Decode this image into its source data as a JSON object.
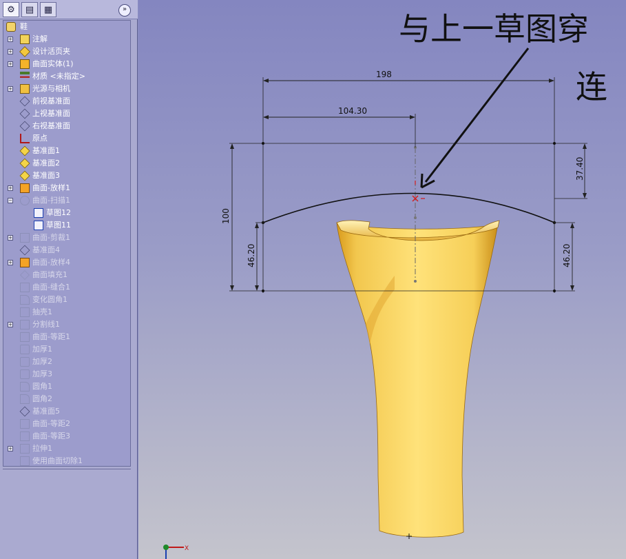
{
  "feature_tree": {
    "root": "鞋",
    "items": [
      {
        "label": "注解",
        "icon": "annotation-icon",
        "expander": "plus",
        "dim": false
      },
      {
        "label": "设计活页夹",
        "icon": "design-binder-icon",
        "expander": "plus",
        "dim": false
      },
      {
        "label": "曲面实体(1)",
        "icon": "surface-bodies-icon",
        "expander": "plus",
        "dim": false
      },
      {
        "label": "材质 <未指定>",
        "icon": "material-icon",
        "expander": "none",
        "dim": false
      },
      {
        "label": "光源与相机",
        "icon": "lights-icon",
        "expander": "plus",
        "dim": false
      },
      {
        "label": "前视基准面",
        "icon": "plane-icon",
        "expander": "none",
        "dim": false
      },
      {
        "label": "上视基准面",
        "icon": "plane-icon",
        "expander": "none",
        "dim": false
      },
      {
        "label": "右视基准面",
        "icon": "plane-icon",
        "expander": "none",
        "dim": false
      },
      {
        "label": "原点",
        "icon": "origin-icon",
        "expander": "none",
        "dim": false
      },
      {
        "label": "基准面1",
        "icon": "ref-plane-icon",
        "expander": "none",
        "dim": false
      },
      {
        "label": "基准面2",
        "icon": "ref-plane-icon",
        "expander": "none",
        "dim": false
      },
      {
        "label": "基准面3",
        "icon": "ref-plane-icon",
        "expander": "none",
        "dim": false
      },
      {
        "label": "曲面-放样1",
        "icon": "loft-icon",
        "expander": "plus",
        "dim": false
      },
      {
        "label": "曲面-扫描1",
        "icon": "sweep-icon",
        "expander": "minus",
        "dim": true
      },
      {
        "label": "草图12",
        "icon": "sketch-icon",
        "expander": "none",
        "dim": false,
        "sub": true
      },
      {
        "label": "草图11",
        "icon": "sketch-icon",
        "expander": "none",
        "dim": false,
        "sub": true
      },
      {
        "label": "曲面-剪裁1",
        "icon": "trim-icon",
        "expander": "plus",
        "dim": true
      },
      {
        "label": "基准面4",
        "icon": "plane-icon",
        "expander": "none",
        "dim": true
      },
      {
        "label": "曲面-放样4",
        "icon": "loft-icon",
        "expander": "plus",
        "dim": true
      },
      {
        "label": "曲面填充1",
        "icon": "fill-icon",
        "expander": "none",
        "dim": true
      },
      {
        "label": "曲面-缝合1",
        "icon": "knit-icon",
        "expander": "none",
        "dim": true
      },
      {
        "label": "变化圆角1",
        "icon": "fillet-icon",
        "expander": "none",
        "dim": true
      },
      {
        "label": "抽壳1",
        "icon": "shell-icon",
        "expander": "none",
        "dim": true
      },
      {
        "label": "分割线1",
        "icon": "split-line-icon",
        "expander": "plus",
        "dim": true
      },
      {
        "label": "曲面-等距1",
        "icon": "offset-icon",
        "expander": "none",
        "dim": true
      },
      {
        "label": "加厚1",
        "icon": "thicken-icon",
        "expander": "none",
        "dim": true
      },
      {
        "label": "加厚2",
        "icon": "thicken-icon",
        "expander": "none",
        "dim": true
      },
      {
        "label": "加厚3",
        "icon": "thicken-icon",
        "expander": "none",
        "dim": true
      },
      {
        "label": "圆角1",
        "icon": "fillet-icon",
        "expander": "none",
        "dim": true
      },
      {
        "label": "圆角2",
        "icon": "fillet-icon",
        "expander": "none",
        "dim": true
      },
      {
        "label": "基准面5",
        "icon": "plane-icon",
        "expander": "none",
        "dim": true
      },
      {
        "label": "曲面-等距2",
        "icon": "offset-icon",
        "expander": "none",
        "dim": true
      },
      {
        "label": "曲面-等距3",
        "icon": "offset-icon",
        "expander": "none",
        "dim": true
      },
      {
        "label": "拉伸1",
        "icon": "extrude-icon",
        "expander": "plus",
        "dim": true
      },
      {
        "label": "使用曲面切除1",
        "icon": "surface-cut-icon",
        "expander": "none",
        "dim": true
      }
    ]
  },
  "dimensions": {
    "width_total": "198",
    "width_half": "104.30",
    "height_total": "100",
    "offset_top": "37.40",
    "end_left": "46.20",
    "end_right": "46.20"
  },
  "annotation": {
    "line1": "与上一草图穿",
    "line2": "连"
  },
  "triad": {
    "x_label": "X"
  },
  "colors": {
    "accent": "#1a3fb0",
    "sketch": "#111111",
    "part": "#f5c94a"
  }
}
